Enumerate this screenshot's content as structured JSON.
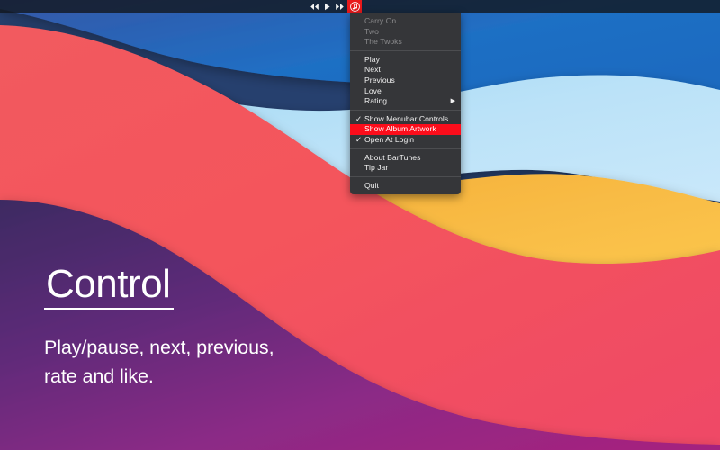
{
  "menubar": {
    "controls": [
      {
        "name": "previous-button",
        "icon": "rewind-icon",
        "label": "Previous"
      },
      {
        "name": "play-button",
        "icon": "play-icon",
        "label": "Play"
      },
      {
        "name": "next-button",
        "icon": "fast-forward-icon",
        "label": "Next"
      }
    ],
    "app_badge": {
      "label": "BarTunes",
      "icon": "music-note-icon",
      "color": "#e8191b"
    }
  },
  "menu": {
    "now_playing": {
      "track": "Carry On",
      "album": "Two",
      "artist": "The Twoks"
    },
    "actions": [
      {
        "label": "Play",
        "name": "menu-item-play"
      },
      {
        "label": "Next",
        "name": "menu-item-next"
      },
      {
        "label": "Previous",
        "name": "menu-item-previous"
      },
      {
        "label": "Love",
        "name": "menu-item-love"
      },
      {
        "label": "Rating",
        "name": "menu-item-rating",
        "submenu": true
      }
    ],
    "toggles": [
      {
        "label": "Show Menubar Controls",
        "checked": true,
        "highlighted": false
      },
      {
        "label": "Show Album Artwork",
        "checked": false,
        "highlighted": true
      },
      {
        "label": "Open At Login",
        "checked": true,
        "highlighted": false
      }
    ],
    "info": [
      {
        "label": "About BarTunes",
        "name": "menu-item-about"
      },
      {
        "label": "Tip Jar",
        "name": "menu-item-tip-jar"
      }
    ],
    "quit": {
      "label": "Quit",
      "name": "menu-item-quit"
    },
    "check_glyph": "✓",
    "submenu_glyph": "▶",
    "highlight_color": "#fc0d1b"
  },
  "hero": {
    "title": "Control",
    "subtitle": "Play/pause, next, previous,\nrate and like."
  },
  "wallpaper": {
    "colors": {
      "navy": "#1d3557",
      "blue": "#1f6fc4",
      "light_blue": "#b3dff5",
      "orange": "#f7b23f",
      "coral": "#f4545c",
      "purple": "#7b2a86",
      "deep_purple": "#3f2a63"
    }
  }
}
